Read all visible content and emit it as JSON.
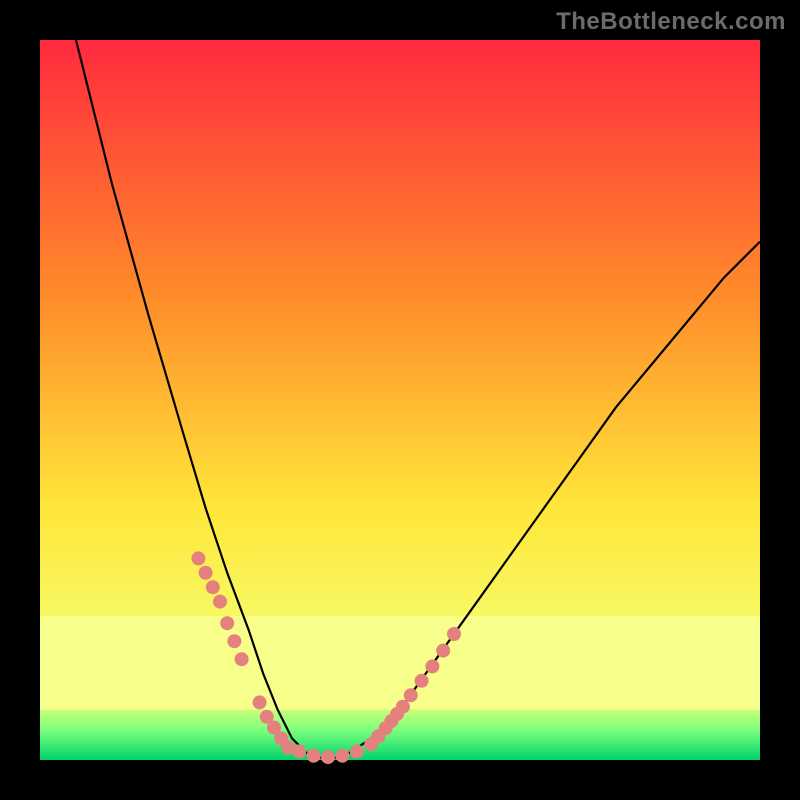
{
  "watermark": "TheBottleneck.com",
  "colors": {
    "background": "#000000",
    "gradient_top": "#ff2a3f",
    "gradient_mid1": "#ff8a2a",
    "gradient_mid2": "#ffe63a",
    "gradient_low": "#f5ff70",
    "green_top": "#c9ff7a",
    "green_mid": "#7dff7d",
    "green_bottom": "#00d46a",
    "curve": "#000000",
    "dots": "#e4817f"
  },
  "chart_data": {
    "type": "line",
    "title": "",
    "xlabel": "",
    "ylabel": "",
    "xlim": [
      0,
      100
    ],
    "ylim": [
      0,
      100
    ],
    "series": [
      {
        "name": "bottleneck-curve",
        "x": [
          0,
          5,
          10,
          15,
          20,
          23,
          26,
          29,
          31,
          33,
          35,
          37,
          40,
          43,
          46,
          50,
          55,
          60,
          65,
          70,
          75,
          80,
          85,
          90,
          95,
          100
        ],
        "values": [
          140,
          100,
          80,
          62,
          45,
          35,
          26,
          18,
          12,
          7,
          3,
          1,
          0,
          1,
          3,
          7,
          14,
          21,
          28,
          35,
          42,
          49,
          55,
          61,
          67,
          72
        ]
      }
    ],
    "markers": [
      {
        "name": "dots-left",
        "x": [
          22,
          23,
          24,
          25,
          26,
          27,
          28,
          30.5,
          31.5,
          32.5,
          33.5
        ],
        "values": [
          28,
          26,
          24,
          22,
          19,
          16.5,
          14,
          8,
          6,
          4.5,
          3
        ]
      },
      {
        "name": "dots-bottom",
        "x": [
          34.5,
          36,
          38,
          40,
          42,
          44,
          46
        ],
        "values": [
          1.7,
          1.2,
          0.6,
          0.4,
          0.6,
          1.2,
          2.2
        ]
      },
      {
        "name": "dots-right",
        "x": [
          47,
          48,
          48.8,
          49.6,
          50.4,
          51.5,
          53,
          54.5,
          56,
          57.5
        ],
        "values": [
          3.3,
          4.4,
          5.4,
          6.4,
          7.4,
          9,
          11,
          13,
          15.2,
          17.5
        ]
      }
    ],
    "bands": [
      {
        "name": "pale-yellow",
        "from_y": 20,
        "to_y": 7,
        "color": "#f7ff8a"
      },
      {
        "name": "green-grad",
        "from_y": 7,
        "to_y": 0,
        "color": "gradient-green"
      }
    ]
  }
}
